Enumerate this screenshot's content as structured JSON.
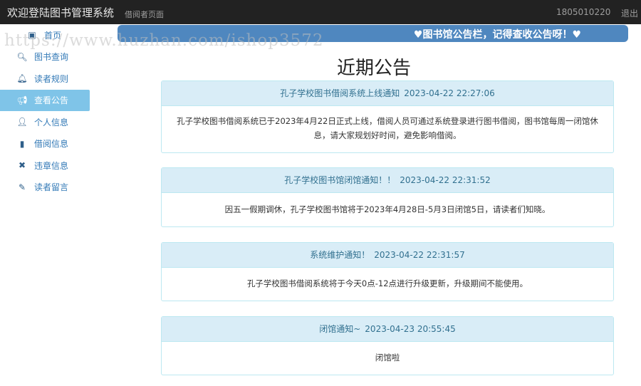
{
  "header": {
    "title": "欢迎登陆图书管理系统",
    "subtitle": "借阅者页面",
    "username": "1805010220",
    "logout": "退出"
  },
  "sidebar": {
    "items": [
      {
        "label": "首页",
        "icon": "image-icon",
        "glyph": "▣"
      },
      {
        "label": "图书查询",
        "icon": "search-icon",
        "glyph": "🔍︎"
      },
      {
        "label": "读者规则",
        "icon": "bell-icon",
        "glyph": "🔔︎"
      },
      {
        "label": "查看公告",
        "icon": "bullhorn-icon",
        "glyph": "📢︎"
      },
      {
        "label": "个人信息",
        "icon": "user-icon",
        "glyph": "👤︎"
      },
      {
        "label": "借阅信息",
        "icon": "book-icon",
        "glyph": "▮"
      },
      {
        "label": "违章信息",
        "icon": "remove-icon",
        "glyph": "✖"
      },
      {
        "label": "读者留言",
        "icon": "pencil-icon",
        "glyph": "✎"
      }
    ],
    "active_index": 3
  },
  "banner": {
    "text": "♥图书馆公告栏，记得查收公告呀！♥"
  },
  "watermark": "https://www.huzhan.com/ishop3572",
  "page_title": "近期公告",
  "notices": [
    {
      "title": "孔子学校图书借阅系统上线通知",
      "date": "2023-04-22 22:27:06",
      "body": "孔子学校图书借阅系统已于2023年4月22日正式上线，借阅人员可通过系统登录进行图书借阅，图书馆每周一闭馆休息，请大家规划好时间，避免影响借阅。"
    },
    {
      "title": "孔子学校图书馆闭馆通知！！",
      "date": "2023-04-22 22:31:52",
      "body": "因五一假期调休，孔子学校图书馆将于2023年4月28日-5月3日闭馆5日，请读者们知晓。"
    },
    {
      "title": "系统维护通知！",
      "date": "2023-04-22 22:31:57",
      "body": "孔子学校图书借阅系统将于今天0点-12点进行升级更新，升级期间不能使用。"
    },
    {
      "title": "闭馆通知~",
      "date": "2023-04-23 20:55:45",
      "body": "闭馆啦"
    }
  ],
  "colors": {
    "topbar": "#222222",
    "banner": "#4f87bf",
    "active_nav": "#7fc4e8",
    "panel_heading": "#d9edf7",
    "panel_border": "#bce8f1"
  }
}
